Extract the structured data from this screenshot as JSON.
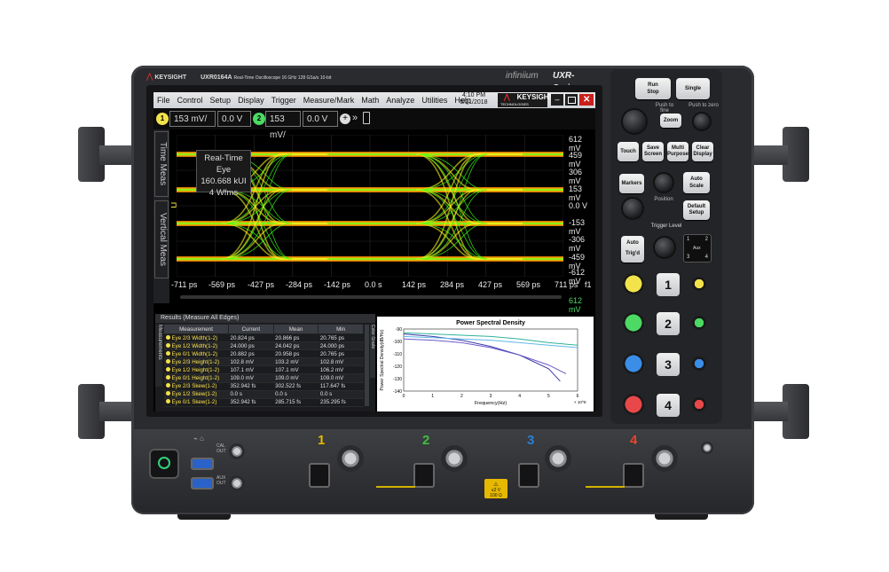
{
  "brand": {
    "logo": "KEYSIGHT",
    "model": "UXR0164A",
    "model_desc": "Real-Time Oscilloscope  16 GHz  128 GSa/s  10-bit",
    "series_script": "infiniium",
    "series": "UXR-Series"
  },
  "menu": {
    "items": [
      "File",
      "Control",
      "Setup",
      "Display",
      "Trigger",
      "Measure/Mark",
      "Math",
      "Analyze",
      "Utilities",
      "Help"
    ],
    "time": "4:10 PM",
    "date": "5/21/2018",
    "screen_logo": "KEYSIGHT",
    "screen_logo_sub": "TECHNOLOGIES"
  },
  "toolbar": {
    "ch1_scale": "153 mV/",
    "ch1_offset": "0.0 V",
    "ch2_scale": "153 mV/",
    "ch2_offset": "0.0 V",
    "ch1_num": "1",
    "ch2_num": "2"
  },
  "side_tabs": [
    "Time Meas",
    "Vertical Meas"
  ],
  "waveform": {
    "y_labels": [
      "612 mV",
      "459 mV",
      "306 mV",
      "153 mV",
      "0.0 V",
      "-153 mV",
      "-306 mV",
      "-459 mV",
      "-612 mV"
    ],
    "x_labels": [
      "-711 ps",
      "-569 ps",
      "-427 ps",
      "-284 ps",
      "-142 ps",
      "0.0 s",
      "142 ps",
      "284 ps",
      "427 ps",
      "569 ps",
      "711 ps"
    ],
    "f1_label": "f1",
    "ch_marker": "612 mV",
    "eye_box": {
      "title": "Real-Time Eye",
      "value": "160.668 kUI",
      "wfms": "4 Wfms"
    },
    "colors": {
      "trace_center": "#39ff14",
      "trace_mid": "#f4f01a",
      "trace_edge": "#ff8a00"
    }
  },
  "results": {
    "title": "Results (Measure All Edges)",
    "side_label": "Measurements",
    "color_grade_tab": "Color Grade",
    "columns": [
      "Measurement",
      "Current",
      "Mean",
      "Min"
    ],
    "rows": [
      [
        "Eye 2/3 Width(1-2)",
        "20.824 ps",
        "20.866 ps",
        "20.765 ps"
      ],
      [
        "Eye 1/2 Width(1-2)",
        "24.000 ps",
        "24.042 ps",
        "24.000 ps"
      ],
      [
        "Eye 0/1 Width(1-2)",
        "20.882 ps",
        "20.958 ps",
        "20.765 ps"
      ],
      [
        "Eye 2/3 Height(1-2)",
        "102.8 mV",
        "103.2 mV",
        "102.8 mV"
      ],
      [
        "Eye 1/2 Height(1-2)",
        "107.1 mV",
        "107.1 mV",
        "106.2 mV"
      ],
      [
        "Eye 0/1 Height(1-2)",
        "109.0 mV",
        "109.0 mV",
        "109.0 mV"
      ],
      [
        "Eye 2/3 Skew(1-2)",
        "352.942 fs",
        "302.522 fs",
        "117.647 fs"
      ],
      [
        "Eye 1/2 Skew(1-2)",
        "0.0 s",
        "0.0 s",
        "0.0 s"
      ],
      [
        "Eye 0/1 Skew(1-2)",
        "352.942 fs",
        "285.715 fs",
        "235.295 fs"
      ]
    ]
  },
  "chart_data": {
    "type": "line",
    "title": "Power Spectral Density",
    "xlabel": "Frequency(Hz)",
    "ylabel": "Power Spectral Density(dB/Hz)",
    "x_multiplier": "× 10^8",
    "xlim": [
      0,
      6
    ],
    "ylim": [
      -140,
      -90
    ],
    "x_ticks": [
      "0",
      "1",
      "2",
      "3",
      "4",
      "5",
      "6"
    ],
    "y_ticks": [
      "-90",
      "-100",
      "-110",
      "-120",
      "-130",
      "-140"
    ],
    "grid": false,
    "series": [
      {
        "color": "#3c3ca8",
        "x": [
          0,
          1,
          2,
          3,
          4,
          5,
          5.4
        ],
        "y": [
          -94,
          -96,
          -99,
          -104,
          -111,
          -122,
          -132
        ]
      },
      {
        "color": "#6a5acd",
        "x": [
          0,
          1,
          2,
          3,
          4,
          5,
          5.6
        ],
        "y": [
          -98,
          -99,
          -101,
          -105,
          -111,
          -119,
          -126
        ]
      },
      {
        "color": "#2db39a",
        "x": [
          0,
          1,
          2,
          3,
          4,
          5,
          6
        ],
        "y": [
          -93,
          -94,
          -95,
          -96,
          -98,
          -101,
          -103
        ]
      },
      {
        "color": "#5fb8e8",
        "x": [
          0,
          1,
          2,
          3,
          4,
          5,
          6
        ],
        "y": [
          -96,
          -97,
          -98,
          -99,
          -101,
          -103,
          -105
        ]
      }
    ]
  },
  "right_panel": {
    "run_stop": [
      "Run",
      "Stop"
    ],
    "single": "Single",
    "push_to_fine": "Push to fine",
    "push_to_zero": "Push to zero",
    "zoom": "Zoom",
    "touch": "Touch",
    "save_screen": [
      "Save",
      "Screen"
    ],
    "multi_purpose": [
      "Multi",
      "Purpose"
    ],
    "clear_display": [
      "Clear",
      "Display"
    ],
    "markers": "Markers",
    "auto_scale": [
      "Auto",
      "Scale"
    ],
    "position": "Position",
    "default_setup": [
      "Default",
      "Setup"
    ],
    "trigger_level": "Trigger Level",
    "auto": "Auto",
    "trigd": "Trig'd",
    "trig_grid": [
      "1",
      "2",
      "Aux",
      "3",
      "4"
    ],
    "channels": [
      "1",
      "2",
      "3",
      "4"
    ],
    "channel_colors": [
      "#f2e34a",
      "#4cd964",
      "#3a8ee8",
      "#e8484a"
    ]
  },
  "front_panel": {
    "cal_out": [
      "CAL",
      "OUT"
    ],
    "aux_out": [
      "AUX",
      "OUT"
    ],
    "input_numbers": [
      "1",
      "2",
      "3",
      "4"
    ],
    "input_colors": [
      "#e6b800",
      "#3fbf3f",
      "#2a7fd4",
      "#e4452f"
    ],
    "warning_tag": [
      "≤2 V",
      "100 Ω"
    ]
  }
}
